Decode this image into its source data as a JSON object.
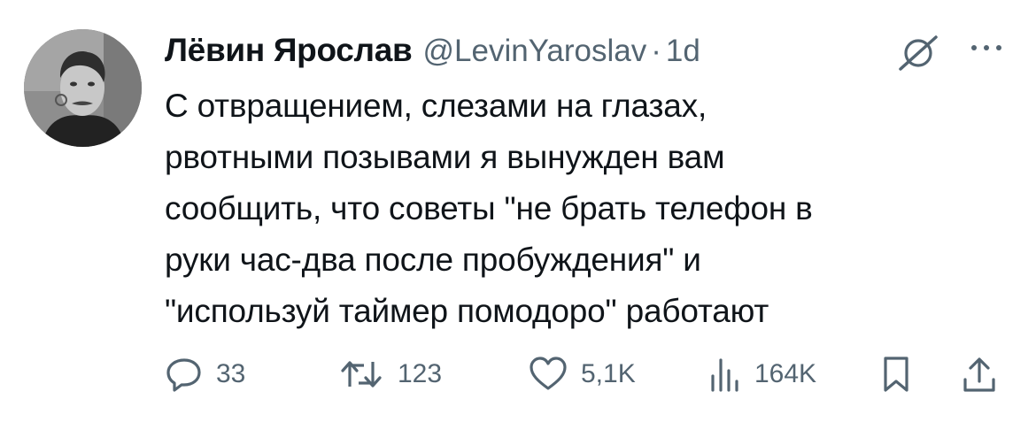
{
  "author": {
    "display_name": "Лёвин Ярослав",
    "handle": "@LevinYaroslav",
    "separator": "·",
    "time": "1d"
  },
  "tweet": {
    "lines": [
      "С отвращением, слезами на глазах,",
      "рвотными позывами я вынужден вам",
      "сообщить, что советы \"не брать телефон в",
      "руки час-два после пробуждения\" и",
      "\"используй таймер помодоро\" работают"
    ]
  },
  "actions": {
    "replies": "33",
    "reposts": "123",
    "likes": "5,1K",
    "views": "164K"
  },
  "icons": {
    "grok": "grok-icon",
    "more": "more-icon",
    "reply": "reply-icon",
    "repost": "repost-icon",
    "like": "like-icon",
    "views": "views-icon",
    "bookmark": "bookmark-icon",
    "share": "share-icon"
  },
  "colors": {
    "text": "#0f1419",
    "secondary": "#536471",
    "background": "#ffffff"
  }
}
